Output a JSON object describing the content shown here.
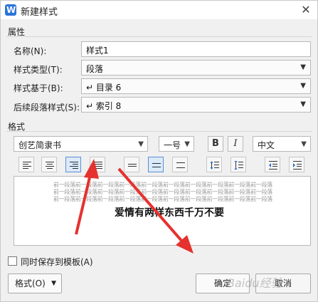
{
  "window": {
    "title": "新建样式",
    "close_glyph": "✕"
  },
  "properties": {
    "section_label": "属性",
    "name_label": "名称(N):",
    "name_value": "样式1",
    "type_label": "样式类型(T):",
    "type_value": "段落",
    "based_label": "样式基于(B):",
    "based_value": "↵ 目录 6",
    "next_label": "后续段落样式(S):",
    "next_value": "↵ 索引 8"
  },
  "format": {
    "section_label": "格式",
    "font_name": "创艺简隶书",
    "font_size": "一号",
    "bold_label": "B",
    "italic_label": "I",
    "language": "中文"
  },
  "preview": {
    "filler_lines": [
      "前一段落前一段落前一段落前一段落前一段落前一段落前一段落前一段落前一段落前一段落",
      "前一段落前一段落前一段落前一段落前一段落前一段落前一段落前一段落前一段落前一段落",
      "前一段落前一段落前一段落前一段落前一段落前一段落前一段落前一段落前一段落前一段落"
    ],
    "sample_text": "爱情有两样东西千万不要"
  },
  "footer": {
    "save_template_label": "同时保存到模板(A)",
    "format_menu_label": "格式(O)",
    "ok_label": "确定",
    "cancel_label": "取消"
  },
  "watermark_text": "Baidu经验",
  "colors": {
    "annotation_arrow": "#e5322f",
    "selected_button": "#dce9f8"
  }
}
